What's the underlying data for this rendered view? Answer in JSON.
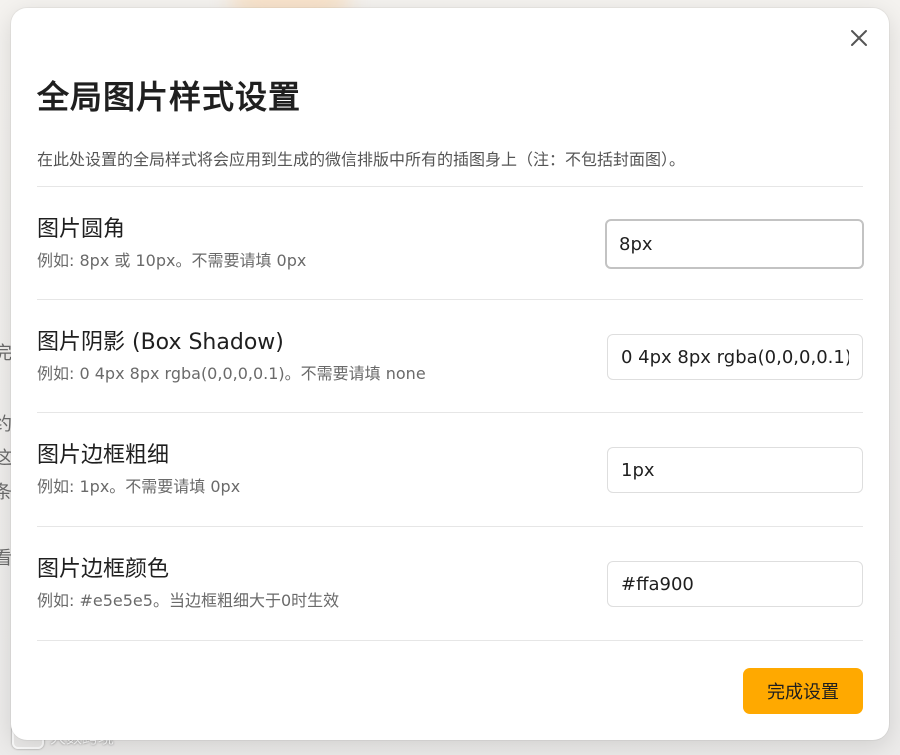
{
  "background": {
    "left_fragments": [
      "完",
      "约",
      "这",
      "条",
      "看"
    ],
    "watermark_text": "大数跨境"
  },
  "dialog": {
    "title": "全局图片样式设置",
    "description": "在此处设置的全局样式将会应用到生成的微信排版中所有的插图身上（注：不包括封面图）。",
    "close_icon": "close-icon",
    "settings": [
      {
        "label": "图片圆角",
        "hint": "例如: 8px 或 10px。不需要请填 0px",
        "value": "8px",
        "focused": true
      },
      {
        "label": "图片阴影 (Box Shadow)",
        "hint": "例如: 0 4px 8px rgba(0,0,0,0.1)。不需要请填 none",
        "value": "0 4px 8px rgba(0,0,0,0.1)",
        "focused": false
      },
      {
        "label": "图片边框粗细",
        "hint": "例如: 1px。不需要请填 0px",
        "value": "1px",
        "focused": false
      },
      {
        "label": "图片边框颜色",
        "hint": "例如: #e5e5e5。当边框粗细大于0时生效",
        "value": "#ffa900",
        "focused": false
      }
    ],
    "done_label": "完成设置"
  },
  "colors": {
    "accent": "#ffa900",
    "text_primary": "#1f1f1f",
    "text_secondary": "#6a6a6a",
    "divider": "#e6e6e6"
  }
}
